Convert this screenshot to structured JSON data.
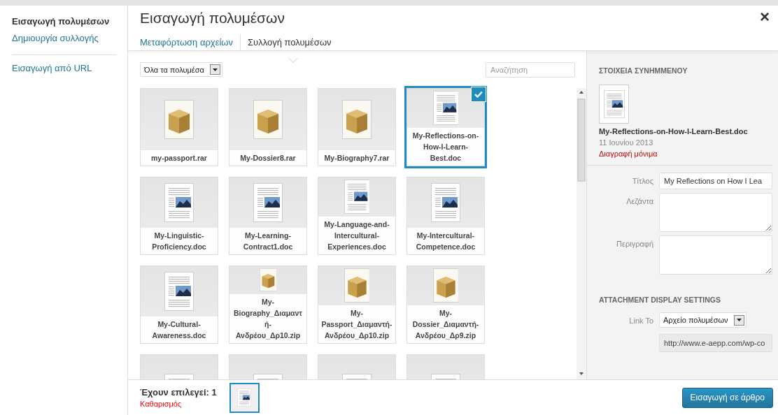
{
  "sidebar": {
    "items": [
      {
        "label": "Εισαγωγή πολυμέσων",
        "selected": true
      },
      {
        "label": "Δημιουργία συλλογής",
        "selected": false
      },
      {
        "label": "Εισαγωγή από URL",
        "selected": false
      }
    ]
  },
  "header": {
    "title": "Εισαγωγή πολυμέσων",
    "close": "×",
    "tabs": [
      {
        "label": "Μεταφόρτωση αρχείων",
        "selected": false
      },
      {
        "label": "Συλλογή πολυμέσων",
        "selected": true
      }
    ]
  },
  "toolbar": {
    "filter": "Όλα τα πολυμέσα",
    "search": {
      "placeholder": "Αναζήτηση"
    }
  },
  "items": [
    {
      "filename": "my-passport.rar",
      "kind": "archive",
      "selected": false
    },
    {
      "filename": "My-Dossier8.rar",
      "kind": "archive",
      "selected": false
    },
    {
      "filename": "My-Biography7.rar",
      "kind": "archive",
      "selected": false
    },
    {
      "filename": "My-Reflections-on-How-I-Learn-Best.doc",
      "kind": "document",
      "selected": true
    },
    {
      "filename": "My-Linguistic-Proficiency.doc",
      "kind": "document",
      "selected": false
    },
    {
      "filename": "My-Learning-Contract1.doc",
      "kind": "document",
      "selected": false
    },
    {
      "filename": "My-Language-and-Intercultural-Experiences.doc",
      "kind": "document",
      "selected": false
    },
    {
      "filename": "My-Intercultural-Competence.doc",
      "kind": "document",
      "selected": false
    },
    {
      "filename": "My-Cultural-Awareness.doc",
      "kind": "document",
      "selected": false
    },
    {
      "filename": "My-Biography_Διαμαντή-Ανδρέου_Δρ10.zip",
      "kind": "archive",
      "selected": false
    },
    {
      "filename": "My-Passport_Διαμαντή-Ανδρέου_Δρ10.zip",
      "kind": "archive",
      "selected": false
    },
    {
      "filename": "My-Dossier_Διαμαντή-Ανδρέου_Δρ9.zip",
      "kind": "archive",
      "selected": false
    },
    {
      "kind": "document",
      "selected": false
    },
    {
      "kind": "document",
      "selected": false
    },
    {
      "kind": "document",
      "selected": false
    },
    {
      "kind": "document",
      "selected": false
    }
  ],
  "details": {
    "heading": "ΣΤΟΙΧΕΙΑ ΣΥΝΗΜΜΕΝΟΥ",
    "filename": "My-Reflections-on-How-I-Learn-Best.doc",
    "date": "11 Ιουνίου 2013",
    "delete": "Διαγραφή μόνιμα",
    "fields": [
      {
        "label": "Τίτλος",
        "value": "My Reflections on How I Lea",
        "kind": "text"
      },
      {
        "label": "Λεζάντα",
        "kind": "textarea"
      },
      {
        "label": "Περιγραφή",
        "kind": "textarea"
      }
    ],
    "display_heading": "ATTACHMENT DISPLAY SETTINGS",
    "link_label": "Link To",
    "link_value": "Αρχείο πολυμέσων",
    "url": "http://www.e-aepp.com/wp-co"
  },
  "footer": {
    "selected_count": "Έχουν επιλεγεί: 1",
    "clear": "Καθαρισμός",
    "insert": "Εισαγωγή σε άρθρο"
  }
}
